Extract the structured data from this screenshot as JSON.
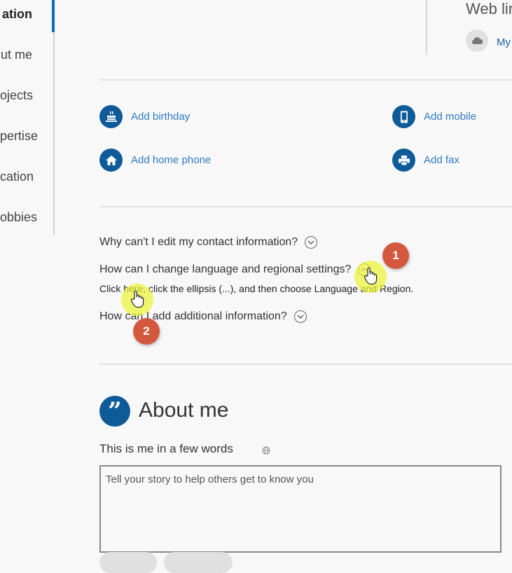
{
  "nav": {
    "items": [
      {
        "label": "ation",
        "active": true
      },
      {
        "label": "ut me"
      },
      {
        "label": "ojects"
      },
      {
        "label": "pertise"
      },
      {
        "label": "cation"
      },
      {
        "label": "obbies"
      }
    ]
  },
  "web_links": {
    "title": "Web lir",
    "onedrive_label": "My",
    "icon": "cloud-icon"
  },
  "contact": {
    "birthday": {
      "label": "Add birthday",
      "icon": "cake-icon"
    },
    "mobile": {
      "label": "Add mobile",
      "icon": "mobile-phone-icon"
    },
    "home_phone": {
      "label": "Add home phone",
      "icon": "home-icon"
    },
    "fax": {
      "label": "Add fax",
      "icon": "printer-icon"
    }
  },
  "faq": {
    "q1": "Why can't I edit my contact information?",
    "q2": "How can I change language and regional settings?",
    "a2": "Click here, click the ellipsis (...), and then choose Language and Region.",
    "q3": "How can I add additional information?"
  },
  "annotations": {
    "step1": "1",
    "step2": "2",
    "highlight_color": "#ecf438",
    "step_color": "#d4583e"
  },
  "about": {
    "title": "About me",
    "subtitle": "This is me in a few words",
    "placeholder": "Tell your story to help others get to know you"
  },
  "colors": {
    "accent": "#0a6fc2",
    "icon_bg": "#0f5a99",
    "link": "#2f7bc2"
  }
}
